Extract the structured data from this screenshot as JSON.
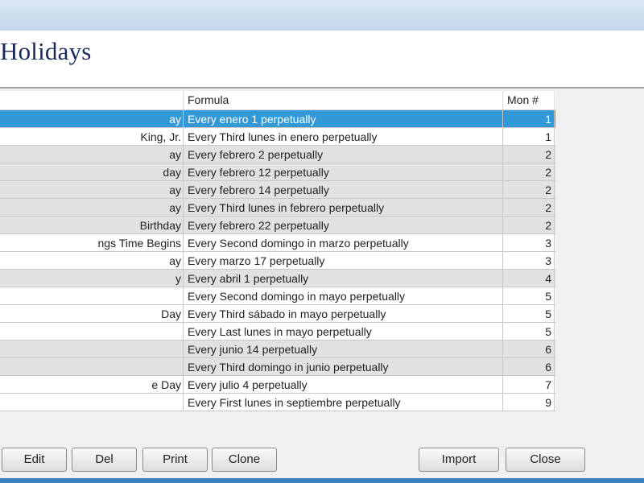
{
  "window": {
    "title": "Holidays"
  },
  "grid": {
    "columns": {
      "name": "",
      "formula": "Formula",
      "mon": "Mon #"
    },
    "rows": [
      {
        "name": "ay",
        "formula": "Every enero 1 perpetually",
        "mon": "1"
      },
      {
        "name": "King, Jr.",
        "formula": "Every Third lunes in enero perpetually",
        "mon": "1"
      },
      {
        "name": "ay",
        "formula": "Every febrero 2 perpetually",
        "mon": "2"
      },
      {
        "name": "day",
        "formula": "Every febrero 12 perpetually",
        "mon": "2"
      },
      {
        "name": "ay",
        "formula": "Every febrero 14 perpetually",
        "mon": "2"
      },
      {
        "name": "ay",
        "formula": "Every Third lunes in febrero perpetually",
        "mon": "2"
      },
      {
        "name": "Birthday",
        "formula": "Every febrero 22 perpetually",
        "mon": "2"
      },
      {
        "name": "ngs Time Begins",
        "formula": "Every Second domingo in marzo perpetually",
        "mon": "3"
      },
      {
        "name": "ay",
        "formula": "Every marzo 17 perpetually",
        "mon": "3"
      },
      {
        "name": "y",
        "formula": "Every abril 1 perpetually",
        "mon": "4"
      },
      {
        "name": "",
        "formula": "Every Second domingo in mayo perpetually",
        "mon": "5"
      },
      {
        "name": "Day",
        "formula": "Every Third sábado in mayo perpetually",
        "mon": "5"
      },
      {
        "name": "",
        "formula": "Every Last lunes in mayo perpetually",
        "mon": "5"
      },
      {
        "name": "",
        "formula": "Every junio 14 perpetually",
        "mon": "6"
      },
      {
        "name": "",
        "formula": "Every Third domingo in junio perpetually",
        "mon": "6"
      },
      {
        "name": "e Day",
        "formula": "Every julio 4 perpetually",
        "mon": "7"
      },
      {
        "name": "",
        "formula": "Every First lunes in septiembre perpetually",
        "mon": "9"
      }
    ]
  },
  "buttons": {
    "edit": "Edit",
    "del": "Del",
    "print": "Print",
    "clone": "Clone",
    "import": "Import",
    "close": "Close"
  }
}
